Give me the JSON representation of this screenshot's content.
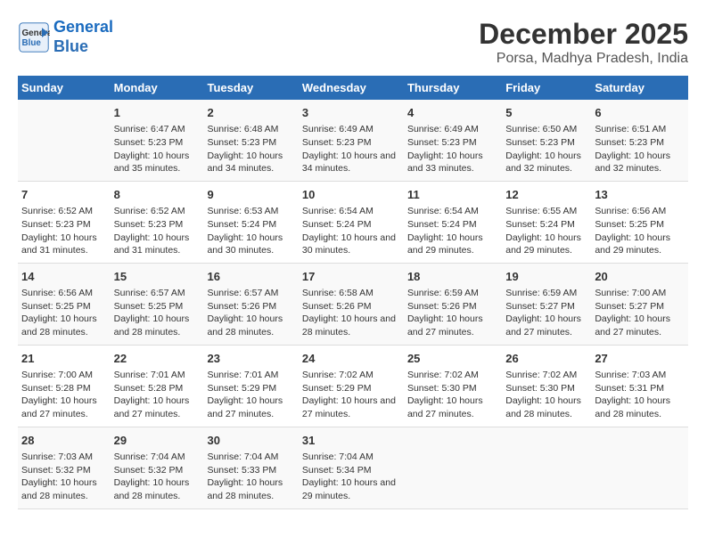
{
  "logo": {
    "line1": "General",
    "line2": "Blue"
  },
  "title": "December 2025",
  "subtitle": "Porsa, Madhya Pradesh, India",
  "headers": [
    "Sunday",
    "Monday",
    "Tuesday",
    "Wednesday",
    "Thursday",
    "Friday",
    "Saturday"
  ],
  "weeks": [
    [
      {
        "day": "",
        "sunrise": "",
        "sunset": "",
        "daylight": ""
      },
      {
        "day": "1",
        "sunrise": "Sunrise: 6:47 AM",
        "sunset": "Sunset: 5:23 PM",
        "daylight": "Daylight: 10 hours and 35 minutes."
      },
      {
        "day": "2",
        "sunrise": "Sunrise: 6:48 AM",
        "sunset": "Sunset: 5:23 PM",
        "daylight": "Daylight: 10 hours and 34 minutes."
      },
      {
        "day": "3",
        "sunrise": "Sunrise: 6:49 AM",
        "sunset": "Sunset: 5:23 PM",
        "daylight": "Daylight: 10 hours and 34 minutes."
      },
      {
        "day": "4",
        "sunrise": "Sunrise: 6:49 AM",
        "sunset": "Sunset: 5:23 PM",
        "daylight": "Daylight: 10 hours and 33 minutes."
      },
      {
        "day": "5",
        "sunrise": "Sunrise: 6:50 AM",
        "sunset": "Sunset: 5:23 PM",
        "daylight": "Daylight: 10 hours and 32 minutes."
      },
      {
        "day": "6",
        "sunrise": "Sunrise: 6:51 AM",
        "sunset": "Sunset: 5:23 PM",
        "daylight": "Daylight: 10 hours and 32 minutes."
      }
    ],
    [
      {
        "day": "7",
        "sunrise": "Sunrise: 6:52 AM",
        "sunset": "Sunset: 5:23 PM",
        "daylight": "Daylight: 10 hours and 31 minutes."
      },
      {
        "day": "8",
        "sunrise": "Sunrise: 6:52 AM",
        "sunset": "Sunset: 5:23 PM",
        "daylight": "Daylight: 10 hours and 31 minutes."
      },
      {
        "day": "9",
        "sunrise": "Sunrise: 6:53 AM",
        "sunset": "Sunset: 5:24 PM",
        "daylight": "Daylight: 10 hours and 30 minutes."
      },
      {
        "day": "10",
        "sunrise": "Sunrise: 6:54 AM",
        "sunset": "Sunset: 5:24 PM",
        "daylight": "Daylight: 10 hours and 30 minutes."
      },
      {
        "day": "11",
        "sunrise": "Sunrise: 6:54 AM",
        "sunset": "Sunset: 5:24 PM",
        "daylight": "Daylight: 10 hours and 29 minutes."
      },
      {
        "day": "12",
        "sunrise": "Sunrise: 6:55 AM",
        "sunset": "Sunset: 5:24 PM",
        "daylight": "Daylight: 10 hours and 29 minutes."
      },
      {
        "day": "13",
        "sunrise": "Sunrise: 6:56 AM",
        "sunset": "Sunset: 5:25 PM",
        "daylight": "Daylight: 10 hours and 29 minutes."
      }
    ],
    [
      {
        "day": "14",
        "sunrise": "Sunrise: 6:56 AM",
        "sunset": "Sunset: 5:25 PM",
        "daylight": "Daylight: 10 hours and 28 minutes."
      },
      {
        "day": "15",
        "sunrise": "Sunrise: 6:57 AM",
        "sunset": "Sunset: 5:25 PM",
        "daylight": "Daylight: 10 hours and 28 minutes."
      },
      {
        "day": "16",
        "sunrise": "Sunrise: 6:57 AM",
        "sunset": "Sunset: 5:26 PM",
        "daylight": "Daylight: 10 hours and 28 minutes."
      },
      {
        "day": "17",
        "sunrise": "Sunrise: 6:58 AM",
        "sunset": "Sunset: 5:26 PM",
        "daylight": "Daylight: 10 hours and 28 minutes."
      },
      {
        "day": "18",
        "sunrise": "Sunrise: 6:59 AM",
        "sunset": "Sunset: 5:26 PM",
        "daylight": "Daylight: 10 hours and 27 minutes."
      },
      {
        "day": "19",
        "sunrise": "Sunrise: 6:59 AM",
        "sunset": "Sunset: 5:27 PM",
        "daylight": "Daylight: 10 hours and 27 minutes."
      },
      {
        "day": "20",
        "sunrise": "Sunrise: 7:00 AM",
        "sunset": "Sunset: 5:27 PM",
        "daylight": "Daylight: 10 hours and 27 minutes."
      }
    ],
    [
      {
        "day": "21",
        "sunrise": "Sunrise: 7:00 AM",
        "sunset": "Sunset: 5:28 PM",
        "daylight": "Daylight: 10 hours and 27 minutes."
      },
      {
        "day": "22",
        "sunrise": "Sunrise: 7:01 AM",
        "sunset": "Sunset: 5:28 PM",
        "daylight": "Daylight: 10 hours and 27 minutes."
      },
      {
        "day": "23",
        "sunrise": "Sunrise: 7:01 AM",
        "sunset": "Sunset: 5:29 PM",
        "daylight": "Daylight: 10 hours and 27 minutes."
      },
      {
        "day": "24",
        "sunrise": "Sunrise: 7:02 AM",
        "sunset": "Sunset: 5:29 PM",
        "daylight": "Daylight: 10 hours and 27 minutes."
      },
      {
        "day": "25",
        "sunrise": "Sunrise: 7:02 AM",
        "sunset": "Sunset: 5:30 PM",
        "daylight": "Daylight: 10 hours and 27 minutes."
      },
      {
        "day": "26",
        "sunrise": "Sunrise: 7:02 AM",
        "sunset": "Sunset: 5:30 PM",
        "daylight": "Daylight: 10 hours and 28 minutes."
      },
      {
        "day": "27",
        "sunrise": "Sunrise: 7:03 AM",
        "sunset": "Sunset: 5:31 PM",
        "daylight": "Daylight: 10 hours and 28 minutes."
      }
    ],
    [
      {
        "day": "28",
        "sunrise": "Sunrise: 7:03 AM",
        "sunset": "Sunset: 5:32 PM",
        "daylight": "Daylight: 10 hours and 28 minutes."
      },
      {
        "day": "29",
        "sunrise": "Sunrise: 7:04 AM",
        "sunset": "Sunset: 5:32 PM",
        "daylight": "Daylight: 10 hours and 28 minutes."
      },
      {
        "day": "30",
        "sunrise": "Sunrise: 7:04 AM",
        "sunset": "Sunset: 5:33 PM",
        "daylight": "Daylight: 10 hours and 28 minutes."
      },
      {
        "day": "31",
        "sunrise": "Sunrise: 7:04 AM",
        "sunset": "Sunset: 5:34 PM",
        "daylight": "Daylight: 10 hours and 29 minutes."
      },
      {
        "day": "",
        "sunrise": "",
        "sunset": "",
        "daylight": ""
      },
      {
        "day": "",
        "sunrise": "",
        "sunset": "",
        "daylight": ""
      },
      {
        "day": "",
        "sunrise": "",
        "sunset": "",
        "daylight": ""
      }
    ]
  ]
}
